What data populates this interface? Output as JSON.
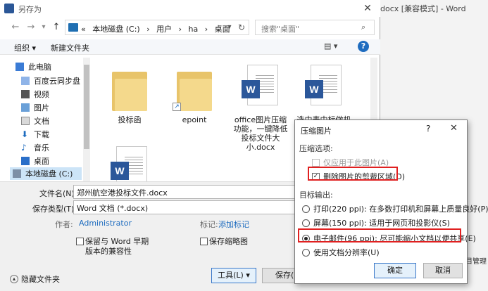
{
  "background_window": {
    "title_fragment": "docx [兼容模式] - Word",
    "side_text_fragment": "目管理"
  },
  "save_dialog": {
    "title": "另存为",
    "close_glyph": "✕",
    "nav": {
      "back": "←",
      "forward": "→",
      "dropdown": "▾",
      "up": "↑"
    },
    "breadcrumbs": [
      "«",
      "本地磁盘 (C:)",
      "›",
      "用户",
      "›",
      "ha",
      "›",
      "桌面"
    ],
    "search_placeholder": "搜索\"桌面\"",
    "toolbar": {
      "organize": "组织 ▾",
      "new_folder": "新建文件夹",
      "view": "▤ ▾",
      "help": "?"
    },
    "sidebar": [
      {
        "label": "此电脑",
        "icon": "computer-icon"
      },
      {
        "label": "百度云同步盘",
        "icon": "cloud-drive-icon"
      },
      {
        "label": "视频",
        "icon": "video-icon"
      },
      {
        "label": "图片",
        "icon": "picture-icon"
      },
      {
        "label": "文档",
        "icon": "document-icon"
      },
      {
        "label": "下载",
        "icon": "download-icon"
      },
      {
        "label": "音乐",
        "icon": "music-icon"
      },
      {
        "label": "桌面",
        "icon": "desktop-icon"
      },
      {
        "label": "本地磁盘 (C:)",
        "icon": "drive-icon"
      }
    ],
    "files": [
      {
        "name": "投标函",
        "type": "folder"
      },
      {
        "name": "epoint",
        "type": "folder-shortcut"
      },
      {
        "name": "office图片压缩功能，一键降低投标文件大小.docx",
        "type": "word"
      },
      {
        "name": "选中表中标做机",
        "type": "word"
      },
      {
        "name": "",
        "type": "word"
      }
    ],
    "filename_label": "文件名(N):",
    "filename_value": "郑州航空港投标文件.docx",
    "filetype_label": "保存类型(T):",
    "filetype_value": "Word 文档 (*.docx)",
    "author_label": "作者:",
    "author_value": "Administrator",
    "tags_label": "标记:",
    "tags_value": "添加标记",
    "compat_checkbox": "保留与 Word 早期版本的兼容性",
    "thumbnail_checkbox": "保存缩略图",
    "hide_folders": "隐藏文件夹",
    "tools_button": "工具(L) ▾",
    "save_button": "保存(S)"
  },
  "compress_dialog": {
    "title": "压缩图片",
    "help": "?",
    "close": "✕",
    "section_options": "压缩选项:",
    "option_this_only": "仅应用于此图片(A)",
    "option_delete_crop": "删除图片的剪裁区域(D)",
    "option_delete_crop_checked": true,
    "section_output": "目标输出:",
    "outputs": [
      {
        "label": "打印(220 ppi): 在多数打印机和屏幕上质量良好(P)",
        "selected": false
      },
      {
        "label": "屏幕(150 ppi): 适用于网页和投影仪(S)",
        "selected": false
      },
      {
        "label": "电子邮件(96 ppi): 尽可能缩小文档以便共享(E)",
        "selected": true
      },
      {
        "label": "使用文档分辨率(U)",
        "selected": false
      }
    ],
    "ok": "确定",
    "cancel": "取消",
    "highlight_color": "#e02020"
  }
}
